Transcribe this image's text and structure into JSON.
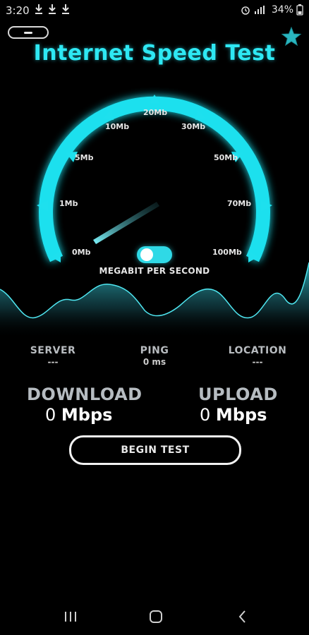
{
  "status": {
    "time": "3:20",
    "battery": "34%"
  },
  "app": {
    "title": "Internet Speed Test",
    "accent": "#2ee8f3"
  },
  "gauge": {
    "ticks": [
      "0Mb",
      "1Mb",
      "5Mb",
      "10Mb",
      "20Mb",
      "30Mb",
      "50Mb",
      "70Mb",
      "100Mb"
    ],
    "unit": "MEGABIT PER SECOND",
    "needle_value": 0
  },
  "stats": {
    "server_label": "SERVER",
    "server_value": "---",
    "ping_label": "PING",
    "ping_value": "0 ms",
    "location_label": "LOCATION",
    "location_value": "---"
  },
  "download": {
    "label": "DOWNLOAD",
    "value": "0",
    "unit": "Mbps"
  },
  "upload": {
    "label": "UPLOAD",
    "value": "0",
    "unit": "Mbps"
  },
  "actions": {
    "begin_label": "BEGIN TEST"
  },
  "icons": {
    "menu": "menu-icon",
    "star": "star-icon",
    "download_notification": "download-icon",
    "recents": "recents-icon",
    "home": "home-icon",
    "back": "back-icon"
  }
}
